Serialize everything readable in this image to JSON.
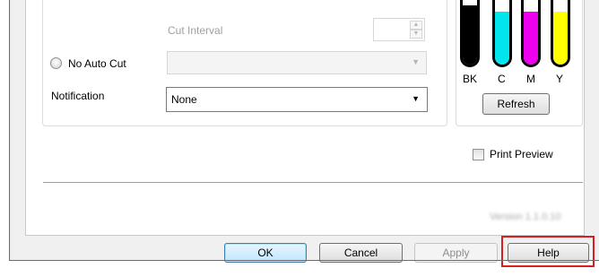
{
  "cut": {
    "cut_interval_label": "Cut Interval",
    "no_auto_cut_label": "No Auto Cut",
    "cut_interval_up": "▲",
    "cut_interval_down": "▼"
  },
  "notification": {
    "label": "Notification",
    "value": "None"
  },
  "ink": {
    "cartridges": [
      {
        "label": "BK",
        "color": "#000000",
        "level": 0.92
      },
      {
        "label": "C",
        "color": "#00e5ee",
        "level": 0.82
      },
      {
        "label": "M",
        "color": "#ee00ee",
        "level": 0.82
      },
      {
        "label": "Y",
        "color": "#ffff00",
        "level": 0.82
      }
    ],
    "refresh_label": "Refresh"
  },
  "print_preview": {
    "label": "Print Preview",
    "checked": false
  },
  "version": "Version 1.1.0.10",
  "buttons": {
    "ok": "OK",
    "cancel": "Cancel",
    "apply": "Apply",
    "help": "Help"
  },
  "colors": {
    "highlight": "#d42020"
  }
}
